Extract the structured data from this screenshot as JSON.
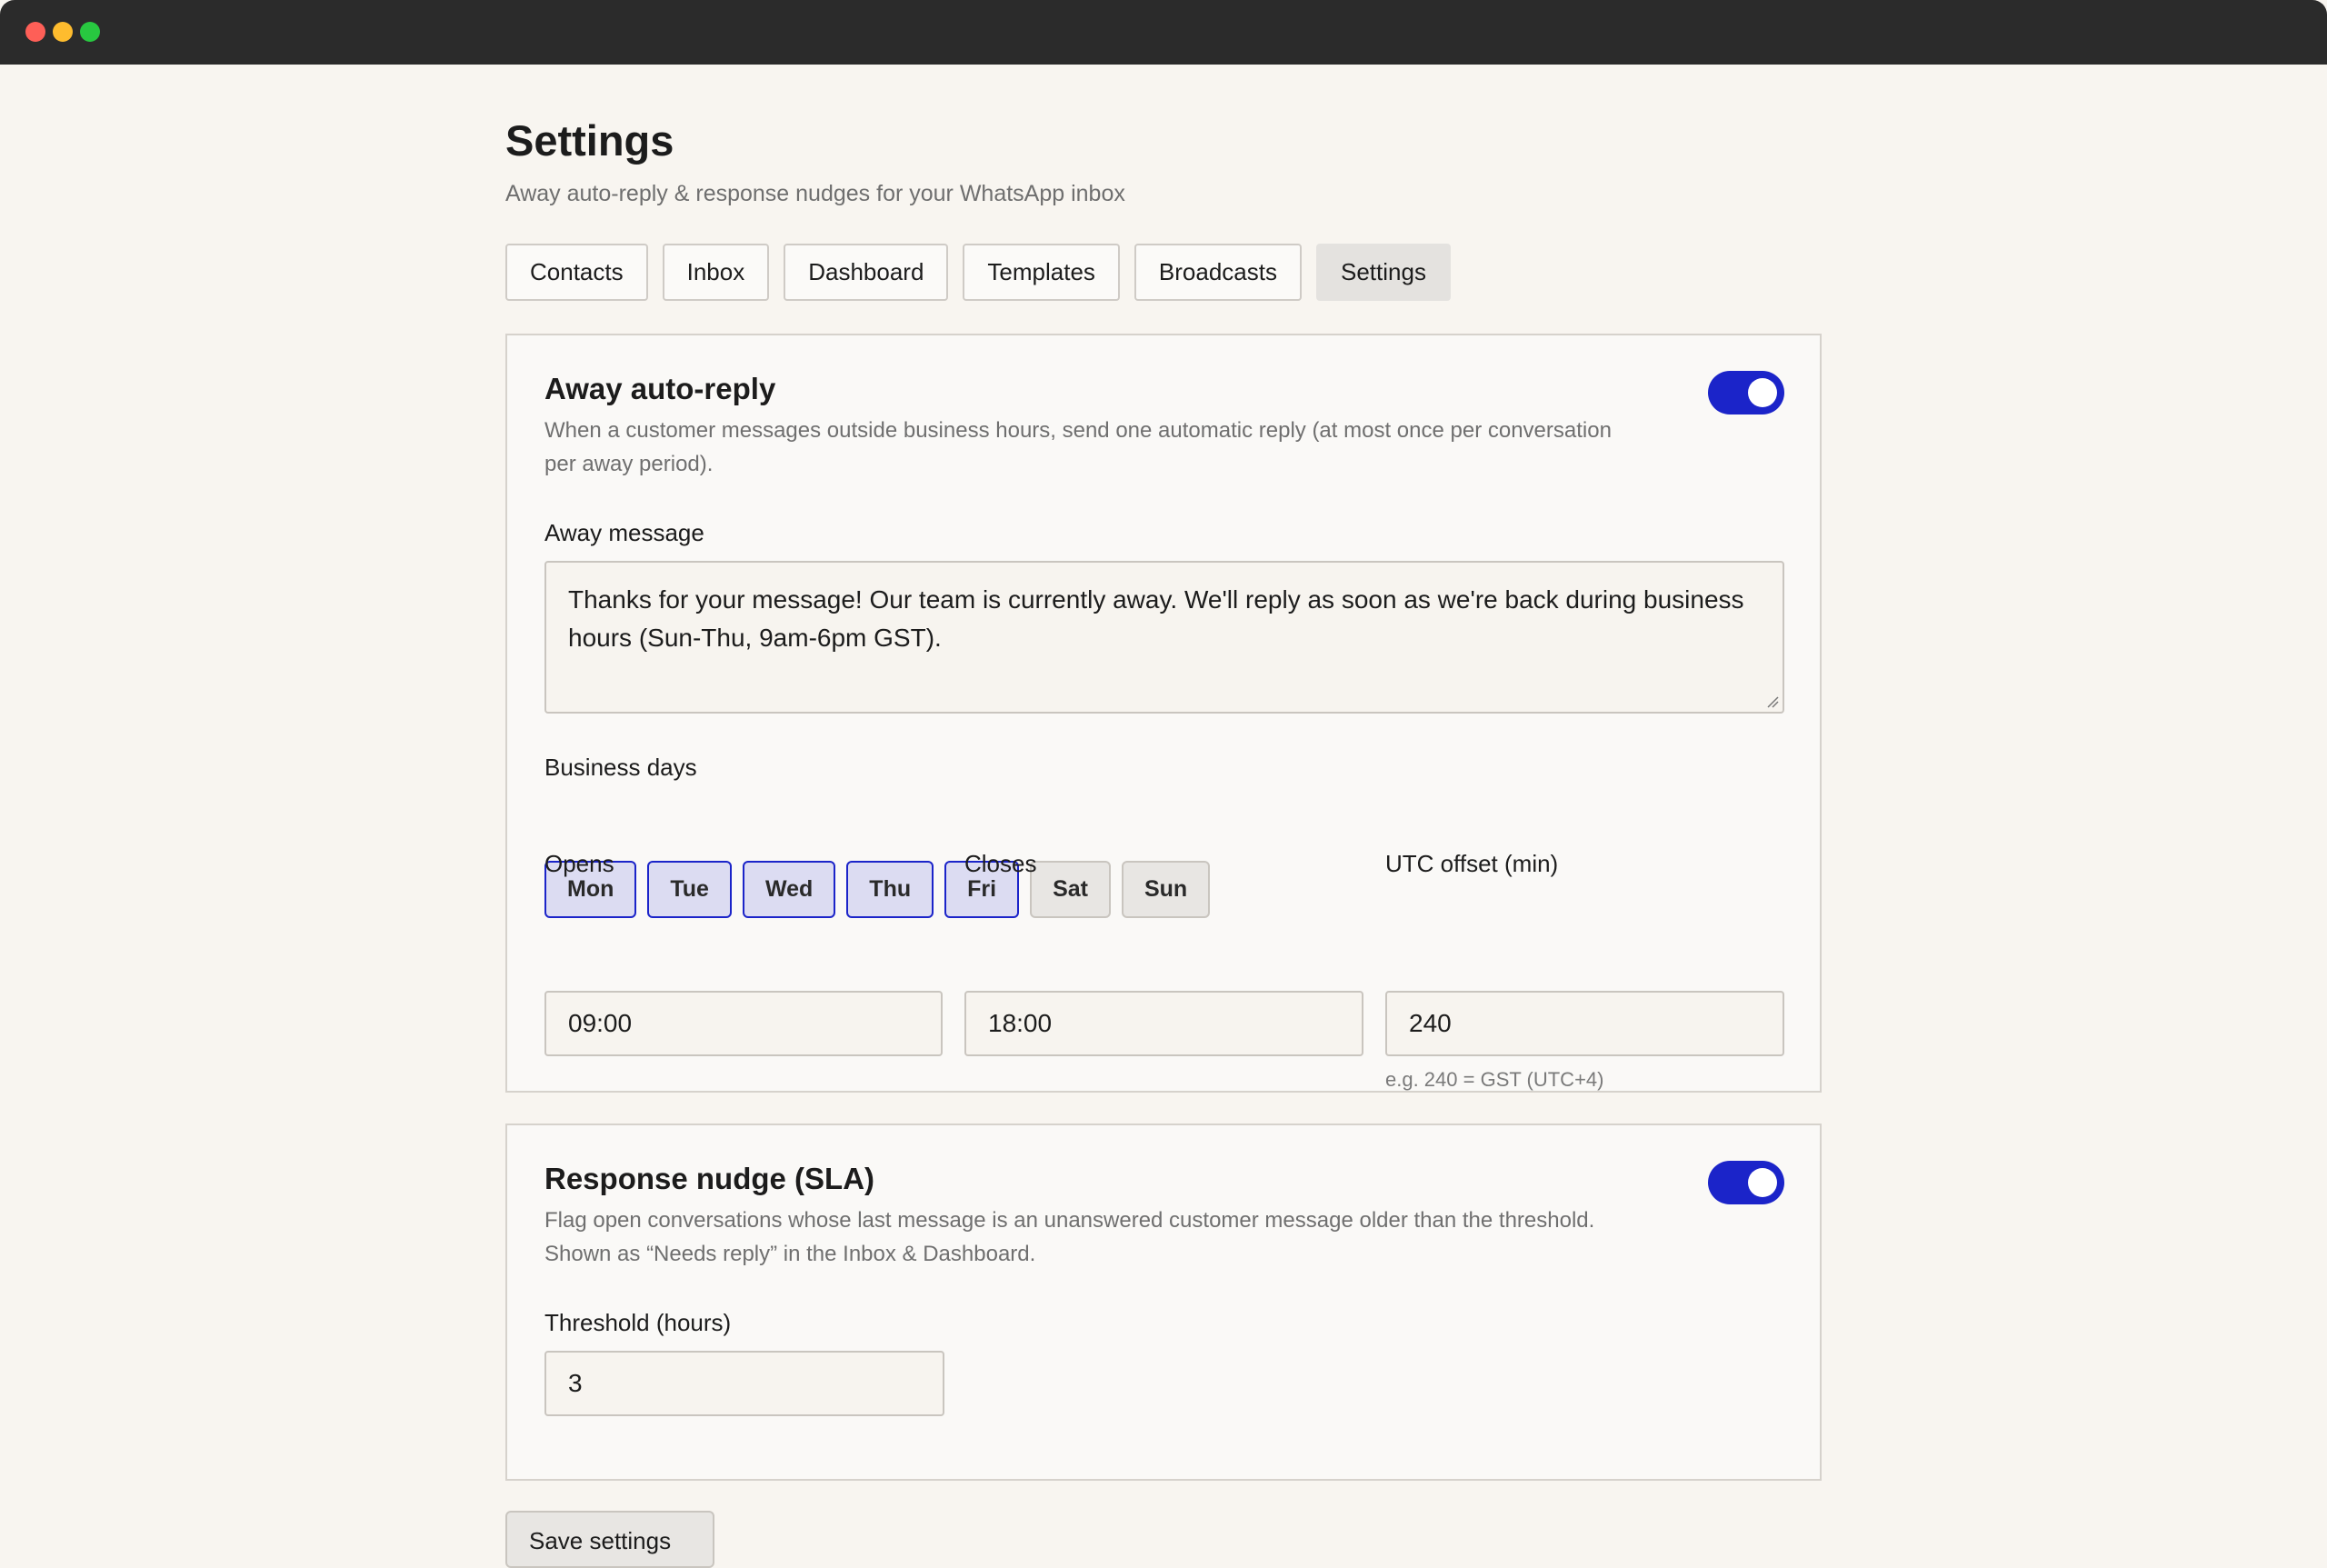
{
  "page": {
    "title": "Settings",
    "subtitle": "Away auto-reply & response nudges for your WhatsApp inbox"
  },
  "tabs": [
    "Contacts",
    "Inbox",
    "Dashboard",
    "Templates",
    "Broadcasts",
    "Settings"
  ],
  "active_tab": "Settings",
  "away": {
    "title": "Away auto-reply",
    "enabled": true,
    "description": "When a customer messages outside business hours, send one automatic reply (at most once per conversation per away period).",
    "message_label": "Away message",
    "message": "Thanks for your message! Our team is currently away. We'll reply as soon as we're back during business hours (Sun-Thu, 9am-6pm GST).",
    "days_label": "Business days",
    "days": [
      {
        "label": "Mon",
        "selected": true
      },
      {
        "label": "Tue",
        "selected": true
      },
      {
        "label": "Wed",
        "selected": true
      },
      {
        "label": "Thu",
        "selected": true
      },
      {
        "label": "Fri",
        "selected": true
      },
      {
        "label": "Sat",
        "selected": false
      },
      {
        "label": "Sun",
        "selected": false
      }
    ],
    "opens_label": "Opens",
    "opens": "09:00",
    "closes_label": "Closes",
    "closes": "18:00",
    "utc_label": "UTC offset (min)",
    "utc": "240",
    "utc_hint": "e.g. 240 = GST (UTC+4)"
  },
  "sla": {
    "title": "Response nudge (SLA)",
    "enabled": true,
    "description": "Flag open conversations whose last message is an unanswered customer message older than the threshold. Shown as “Needs reply” in the Inbox & Dashboard.",
    "threshold_label": "Threshold (hours)",
    "threshold": "3"
  },
  "save_label": "Save settings",
  "colors": {
    "accent": "#1b24c9",
    "selected_day_bg": "#dcdcf2",
    "background": "#f8f5f0"
  }
}
